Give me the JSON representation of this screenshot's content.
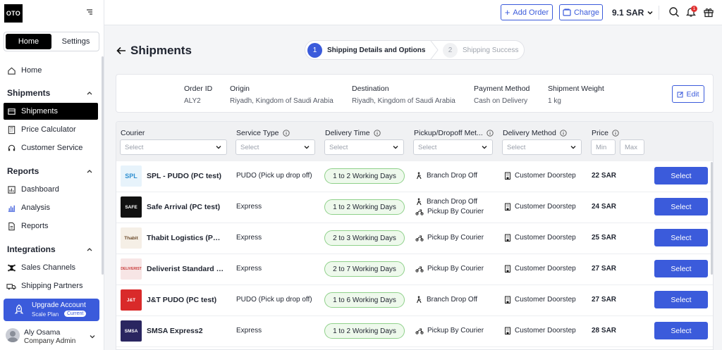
{
  "brand": {
    "logo": "OTO"
  },
  "sidebar": {
    "tabs": [
      "Home",
      "Settings"
    ],
    "home": "Home",
    "sections": [
      {
        "title": "Shipments",
        "items": [
          "Shipments",
          "Price Calculator",
          "Customer Service"
        ]
      },
      {
        "title": "Reports",
        "items": [
          "Dashboard",
          "Analysis",
          "Reports"
        ]
      },
      {
        "title": "Integrations",
        "items": [
          "Sales Channels",
          "Shipping Partners"
        ]
      }
    ],
    "upgrade": {
      "title": "Upgrade Account",
      "plan": "Scale Plan",
      "badge": "Current"
    },
    "user": {
      "name": "Aly Osama",
      "role": "Company Admin"
    }
  },
  "topbar": {
    "add_order": "Add Order",
    "charge": "Charge",
    "balance": "9.1 SAR",
    "notif_count": "1"
  },
  "page": {
    "title": "Shipments"
  },
  "stepper": [
    {
      "num": "1",
      "label": "Shipping Details and Options"
    },
    {
      "num": "2",
      "label": "Shipping Success"
    }
  ],
  "order_info": {
    "headers": [
      "Order ID",
      "Origin",
      "Destination",
      "Payment Method",
      "Shipment Weight"
    ],
    "values": [
      "ALY2",
      "Riyadh, Kingdom of Saudi Arabia",
      "Riyadh, Kingdom of Saudi Arabia",
      "Cash on Delivery",
      "1 kg"
    ],
    "edit": "Edit"
  },
  "table": {
    "headers": [
      "Courier",
      "Service Type",
      "Delivery Time",
      "Pickup/Dropoff Met...",
      "Delivery Method",
      "Price"
    ],
    "select_placeholder": "Select",
    "min_placeholder": "Min",
    "max_placeholder": "Max",
    "select_label": "Select",
    "rows": [
      {
        "logo": "SPL",
        "name": "SPL - PUDO (PC test)",
        "service": "PUDO (Pick up drop off)",
        "time": "1 to 2 Working Days",
        "pickup": [
          "Branch Drop Off"
        ],
        "delivery": "Customer Doorstep",
        "price": "22 SAR"
      },
      {
        "logo": "SAFE",
        "name": "Safe Arrival (PC test)",
        "service": "Express",
        "time": "1 to 2 Working Days",
        "pickup": [
          "Branch Drop Off",
          "Pickup By Courier"
        ],
        "delivery": "Customer Doorstep",
        "price": "24 SAR"
      },
      {
        "logo": "Thabit",
        "name": "Thabit Logistics (PC te...",
        "service": "Express",
        "time": "2 to 3 Working Days",
        "pickup": [
          "Pickup By Courier"
        ],
        "delivery": "Customer Doorstep",
        "price": "25 SAR"
      },
      {
        "logo": "DELIVERIST",
        "name": "Deliverist Standard (P...",
        "service": "Express",
        "time": "2 to 7 Working Days",
        "pickup": [
          "Pickup By Courier"
        ],
        "delivery": "Customer Doorstep",
        "price": "27 SAR"
      },
      {
        "logo": "J&T",
        "name": "J&T PUDO (PC test)",
        "service": "PUDO (Pick up drop off)",
        "time": "1 to 6 Working Days",
        "pickup": [
          "Branch Drop Off"
        ],
        "delivery": "Customer Doorstep",
        "price": "27 SAR"
      },
      {
        "logo": "SMSA",
        "name": "SMSA Express2",
        "service": "Express",
        "time": "1 to 2 Working Days",
        "pickup": [
          "Pickup By Courier"
        ],
        "delivery": "Customer Doorstep",
        "price": "28 SAR"
      }
    ]
  },
  "colors": {
    "accent": "#3b5bdb",
    "pill_border": "#8fd18a",
    "pill_bg": "#eef9ec",
    "badge": "#e03131"
  }
}
